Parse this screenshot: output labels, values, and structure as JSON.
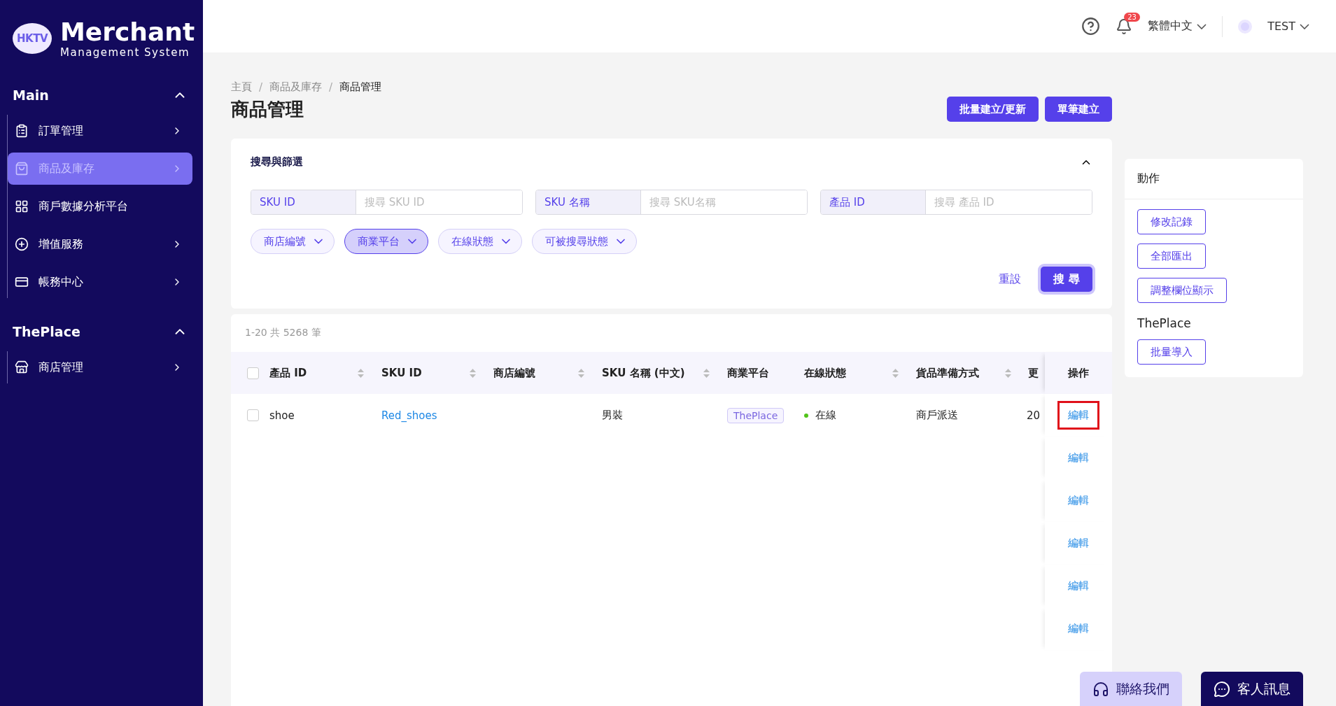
{
  "logo": {
    "badge": "HKTV",
    "title": "Merchant",
    "subtitle": "Management System"
  },
  "sidebar": {
    "sections": [
      {
        "title": "Main",
        "expanded": true,
        "items": [
          {
            "label": "訂單管理",
            "kind": "orders",
            "has_children": true,
            "selected": false
          },
          {
            "label": "商品及庫存",
            "kind": "bag",
            "has_children": true,
            "selected": true
          },
          {
            "label": "商戶數據分析平台",
            "kind": "grid",
            "has_children": false,
            "selected": false
          },
          {
            "label": "增值服務",
            "kind": "plus",
            "has_children": true,
            "selected": false
          },
          {
            "label": "帳務中心",
            "kind": "card",
            "has_children": true,
            "selected": false
          }
        ]
      },
      {
        "title": "ThePlace",
        "expanded": true,
        "items": [
          {
            "label": "商店管理",
            "kind": "store",
            "has_children": true,
            "selected": false
          }
        ]
      }
    ]
  },
  "header": {
    "notifications": "23",
    "language": "繁體中文",
    "user": "TEST"
  },
  "breadcrumb": {
    "items": [
      "主頁",
      "商品及庫存",
      "商品管理"
    ],
    "separator": "/"
  },
  "page_title": "商品管理",
  "page_buttons": [
    "批量建立/更新",
    "單筆建立"
  ],
  "filter": {
    "title": "搜尋與篩選",
    "expanded": true,
    "fields": [
      {
        "label": "SKU ID",
        "placeholder": "搜尋 SKU ID"
      },
      {
        "label": "SKU 名稱",
        "placeholder": "搜尋 SKU名稱"
      },
      {
        "label": "產品 ID",
        "placeholder": "搜尋 產品 ID"
      }
    ],
    "chips": [
      {
        "label": "商店編號",
        "active": false
      },
      {
        "label": "商業平台",
        "active": true
      },
      {
        "label": "在線狀態",
        "active": false
      },
      {
        "label": "可被搜尋狀態",
        "active": false
      }
    ],
    "reset": "重設",
    "search": "搜 尋"
  },
  "table": {
    "count": "1-20 共 5268 筆",
    "columns": [
      {
        "label": "產品 ID",
        "sortable": true
      },
      {
        "label": "SKU ID",
        "sortable": true
      },
      {
        "label": "商店編號",
        "sortable": true
      },
      {
        "label": "SKU 名稱 (中文)",
        "sortable": true
      },
      {
        "label": "商業平台",
        "sortable": false
      },
      {
        "label": "在線狀態",
        "sortable": true
      },
      {
        "label": "貨品準備方式",
        "sortable": true
      },
      {
        "label": "更",
        "sortable": false
      }
    ],
    "action_column": "操作",
    "header_checked": false,
    "rows": [
      {
        "checked": false,
        "cells": [
          "shoe",
          "Red_shoes",
          "",
          "男裝",
          "ThePlace",
          "在線",
          "商戶派送",
          "20"
        ],
        "online": true,
        "action": "編輯",
        "highlighted": true
      },
      {
        "action": "編輯",
        "highlighted": false
      },
      {
        "action": "編輯",
        "highlighted": false
      },
      {
        "action": "編輯",
        "highlighted": false
      },
      {
        "action": "編輯",
        "highlighted": false
      },
      {
        "action": "編輯",
        "highlighted": false
      }
    ]
  },
  "actions_panel": {
    "title": "動作",
    "buttons": [
      "修改記錄",
      "全部匯出",
      "調整欄位顯示"
    ],
    "section": "ThePlace",
    "section_buttons": [
      "批量導入"
    ]
  },
  "floating": {
    "contact": "聯絡我們",
    "chat": "客人訊息"
  }
}
